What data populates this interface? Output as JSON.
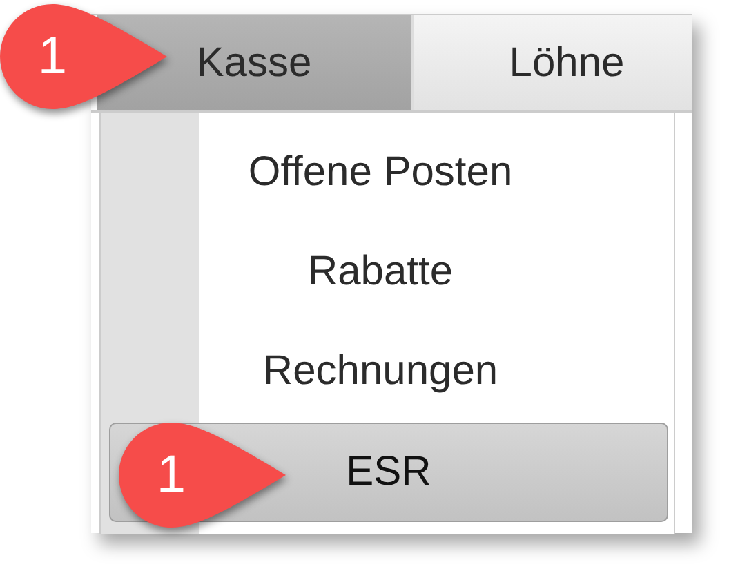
{
  "tabs": [
    {
      "label": "Kasse",
      "selected": true,
      "marker": "1"
    },
    {
      "label": "Löhne",
      "selected": false
    }
  ],
  "menu_items": [
    {
      "label": "Offene Posten",
      "selected": false
    },
    {
      "label": "Rabatte",
      "selected": false
    },
    {
      "label": "Rechnungen",
      "selected": false
    },
    {
      "label": "ESR",
      "selected": true,
      "marker": "1"
    }
  ]
}
